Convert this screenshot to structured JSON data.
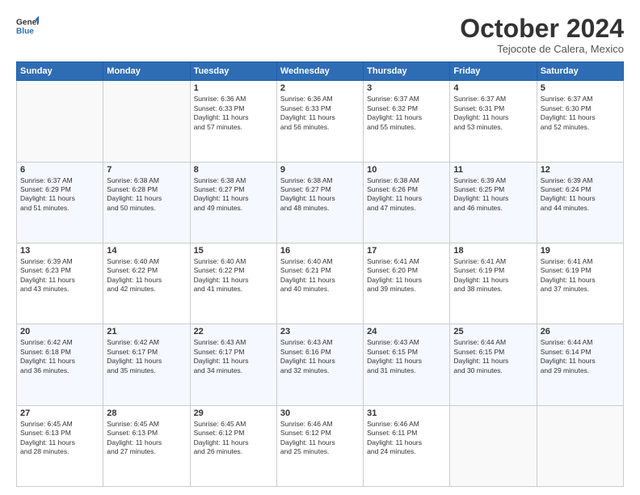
{
  "header": {
    "logo_line1": "General",
    "logo_line2": "Blue",
    "month": "October 2024",
    "location": "Tejocote de Calera, Mexico"
  },
  "weekdays": [
    "Sunday",
    "Monday",
    "Tuesday",
    "Wednesday",
    "Thursday",
    "Friday",
    "Saturday"
  ],
  "weeks": [
    [
      {
        "day": "",
        "info": ""
      },
      {
        "day": "",
        "info": ""
      },
      {
        "day": "1",
        "info": "Sunrise: 6:36 AM\nSunset: 6:33 PM\nDaylight: 11 hours\nand 57 minutes."
      },
      {
        "day": "2",
        "info": "Sunrise: 6:36 AM\nSunset: 6:33 PM\nDaylight: 11 hours\nand 56 minutes."
      },
      {
        "day": "3",
        "info": "Sunrise: 6:37 AM\nSunset: 6:32 PM\nDaylight: 11 hours\nand 55 minutes."
      },
      {
        "day": "4",
        "info": "Sunrise: 6:37 AM\nSunset: 6:31 PM\nDaylight: 11 hours\nand 53 minutes."
      },
      {
        "day": "5",
        "info": "Sunrise: 6:37 AM\nSunset: 6:30 PM\nDaylight: 11 hours\nand 52 minutes."
      }
    ],
    [
      {
        "day": "6",
        "info": "Sunrise: 6:37 AM\nSunset: 6:29 PM\nDaylight: 11 hours\nand 51 minutes."
      },
      {
        "day": "7",
        "info": "Sunrise: 6:38 AM\nSunset: 6:28 PM\nDaylight: 11 hours\nand 50 minutes."
      },
      {
        "day": "8",
        "info": "Sunrise: 6:38 AM\nSunset: 6:27 PM\nDaylight: 11 hours\nand 49 minutes."
      },
      {
        "day": "9",
        "info": "Sunrise: 6:38 AM\nSunset: 6:27 PM\nDaylight: 11 hours\nand 48 minutes."
      },
      {
        "day": "10",
        "info": "Sunrise: 6:38 AM\nSunset: 6:26 PM\nDaylight: 11 hours\nand 47 minutes."
      },
      {
        "day": "11",
        "info": "Sunrise: 6:39 AM\nSunset: 6:25 PM\nDaylight: 11 hours\nand 46 minutes."
      },
      {
        "day": "12",
        "info": "Sunrise: 6:39 AM\nSunset: 6:24 PM\nDaylight: 11 hours\nand 44 minutes."
      }
    ],
    [
      {
        "day": "13",
        "info": "Sunrise: 6:39 AM\nSunset: 6:23 PM\nDaylight: 11 hours\nand 43 minutes."
      },
      {
        "day": "14",
        "info": "Sunrise: 6:40 AM\nSunset: 6:22 PM\nDaylight: 11 hours\nand 42 minutes."
      },
      {
        "day": "15",
        "info": "Sunrise: 6:40 AM\nSunset: 6:22 PM\nDaylight: 11 hours\nand 41 minutes."
      },
      {
        "day": "16",
        "info": "Sunrise: 6:40 AM\nSunset: 6:21 PM\nDaylight: 11 hours\nand 40 minutes."
      },
      {
        "day": "17",
        "info": "Sunrise: 6:41 AM\nSunset: 6:20 PM\nDaylight: 11 hours\nand 39 minutes."
      },
      {
        "day": "18",
        "info": "Sunrise: 6:41 AM\nSunset: 6:19 PM\nDaylight: 11 hours\nand 38 minutes."
      },
      {
        "day": "19",
        "info": "Sunrise: 6:41 AM\nSunset: 6:19 PM\nDaylight: 11 hours\nand 37 minutes."
      }
    ],
    [
      {
        "day": "20",
        "info": "Sunrise: 6:42 AM\nSunset: 6:18 PM\nDaylight: 11 hours\nand 36 minutes."
      },
      {
        "day": "21",
        "info": "Sunrise: 6:42 AM\nSunset: 6:17 PM\nDaylight: 11 hours\nand 35 minutes."
      },
      {
        "day": "22",
        "info": "Sunrise: 6:43 AM\nSunset: 6:17 PM\nDaylight: 11 hours\nand 34 minutes."
      },
      {
        "day": "23",
        "info": "Sunrise: 6:43 AM\nSunset: 6:16 PM\nDaylight: 11 hours\nand 32 minutes."
      },
      {
        "day": "24",
        "info": "Sunrise: 6:43 AM\nSunset: 6:15 PM\nDaylight: 11 hours\nand 31 minutes."
      },
      {
        "day": "25",
        "info": "Sunrise: 6:44 AM\nSunset: 6:15 PM\nDaylight: 11 hours\nand 30 minutes."
      },
      {
        "day": "26",
        "info": "Sunrise: 6:44 AM\nSunset: 6:14 PM\nDaylight: 11 hours\nand 29 minutes."
      }
    ],
    [
      {
        "day": "27",
        "info": "Sunrise: 6:45 AM\nSunset: 6:13 PM\nDaylight: 11 hours\nand 28 minutes."
      },
      {
        "day": "28",
        "info": "Sunrise: 6:45 AM\nSunset: 6:13 PM\nDaylight: 11 hours\nand 27 minutes."
      },
      {
        "day": "29",
        "info": "Sunrise: 6:45 AM\nSunset: 6:12 PM\nDaylight: 11 hours\nand 26 minutes."
      },
      {
        "day": "30",
        "info": "Sunrise: 6:46 AM\nSunset: 6:12 PM\nDaylight: 11 hours\nand 25 minutes."
      },
      {
        "day": "31",
        "info": "Sunrise: 6:46 AM\nSunset: 6:11 PM\nDaylight: 11 hours\nand 24 minutes."
      },
      {
        "day": "",
        "info": ""
      },
      {
        "day": "",
        "info": ""
      }
    ]
  ]
}
